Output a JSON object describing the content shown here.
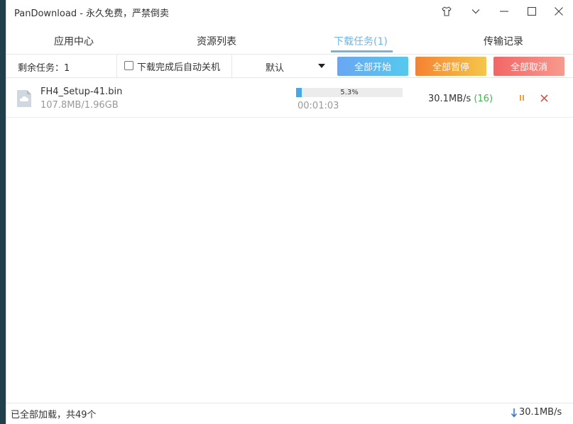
{
  "window": {
    "title": "PanDownload - 永久免费，严禁倒卖"
  },
  "tabs": [
    {
      "label": "应用中心",
      "active": false
    },
    {
      "label": "资源列表",
      "active": false
    },
    {
      "label": "下载任务(1)",
      "active": true
    },
    {
      "label": "传输记录",
      "active": false
    }
  ],
  "toolbar": {
    "remaining_label": "剩余任务：1",
    "shutdown_checkbox_label": "下载完成后自动关机",
    "shutdown_checked": false,
    "sort_value": "默认",
    "start_all_label": "全部开始",
    "pause_all_label": "全部暂停",
    "cancel_all_label": "全部取消"
  },
  "tasks": [
    {
      "file_name": "FH4_Setup-41.bin",
      "size_progress": "107.8MB/1.96GB",
      "progress_label": "5.3%",
      "progress_fraction": 0.053,
      "elapsed": "00:01:03",
      "speed": "30.1MB/s",
      "connections": "(16)",
      "pause_icon": "pause-icon",
      "cancel_icon": "close-icon"
    }
  ],
  "statusbar": {
    "text": "已全部加载，共49个",
    "total_speed": "30.1MB/s"
  },
  "colors": {
    "accent": "#6fb6e8",
    "progress": "#47a7e9",
    "connections": "#3fb34f",
    "pause_icon": "#f0a030",
    "cancel_icon": "#e05050"
  }
}
